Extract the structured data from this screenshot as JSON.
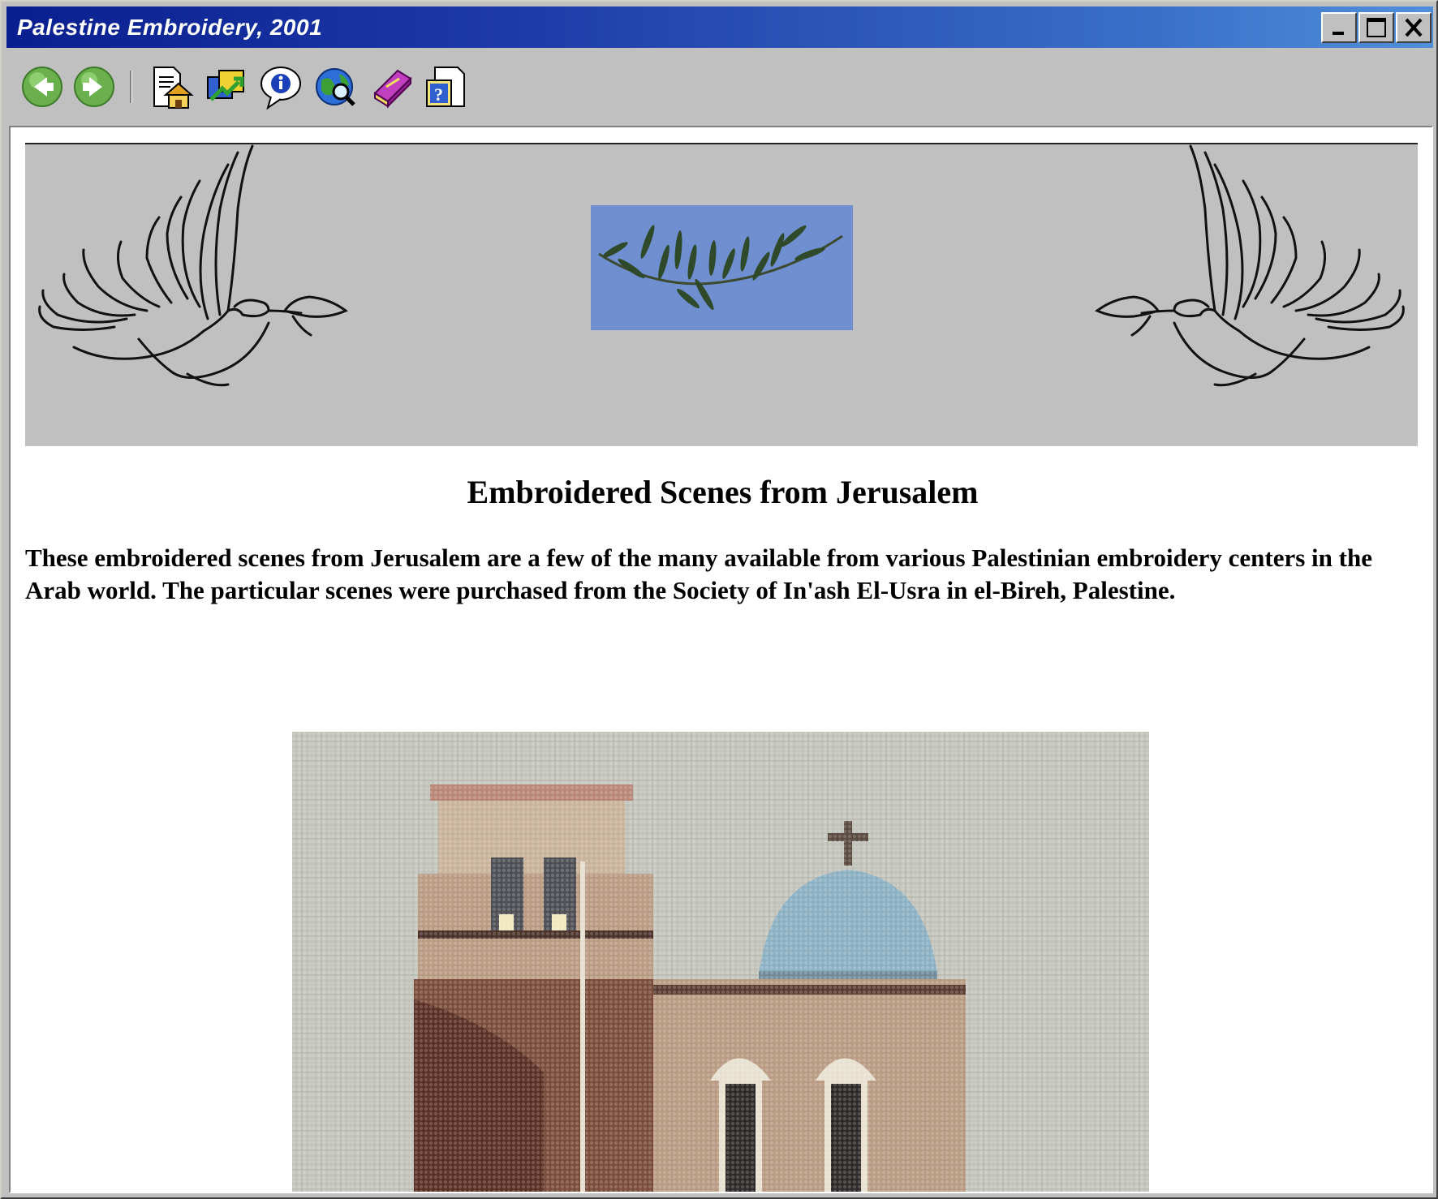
{
  "window": {
    "title": "Palestine Embroidery, 2001",
    "buttons": [
      "minimize",
      "maximize",
      "close"
    ]
  },
  "toolbar": {
    "icons": [
      "back-arrow-icon",
      "forward-arrow-icon",
      "home-page-icon",
      "sync-arrows-icon",
      "info-balloon-icon",
      "web-search-icon",
      "book-icon",
      "help-document-icon"
    ]
  },
  "page": {
    "heading": "Embroidered Scenes from Jerusalem",
    "intro": "These embroidered scenes from Jerusalem are a few of the many available from various Palestinian embroidery centers in the Arab world.  The particular scenes were purchased from the  Society of In'ash El-Usra in el-Bireh, Palestine."
  },
  "colors": {
    "titlebar_start": "#0a1f8f",
    "titlebar_end": "#4f8fda",
    "chrome": "#c0c0c0",
    "banner": "#c0c0c0",
    "olive_photo_bg": "#6f8fd0"
  }
}
